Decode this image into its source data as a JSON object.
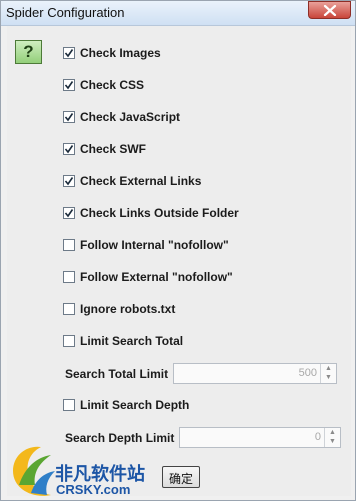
{
  "window": {
    "title": "Spider Configuration"
  },
  "help": {
    "glyph": "?"
  },
  "options": [
    {
      "label": "Check Images",
      "checked": true
    },
    {
      "label": "Check CSS",
      "checked": true
    },
    {
      "label": "Check JavaScript",
      "checked": true
    },
    {
      "label": "Check SWF",
      "checked": true
    },
    {
      "label": "Check External Links",
      "checked": true
    },
    {
      "label": "Check Links Outside Folder",
      "checked": true
    },
    {
      "label": "Follow Internal \"nofollow\"",
      "checked": false
    },
    {
      "label": "Follow External \"nofollow\"",
      "checked": false
    },
    {
      "label": "Ignore robots.txt",
      "checked": false
    },
    {
      "label": "Limit Search Total",
      "checked": false
    }
  ],
  "search_total": {
    "label": "Search Total Limit",
    "value": "500"
  },
  "limit_depth": {
    "label": "Limit Search Depth",
    "checked": false
  },
  "search_depth": {
    "label": "Search Depth Limit",
    "value": "0"
  },
  "ok_button": {
    "label": "确定"
  },
  "watermark": {
    "text_cn": "非凡软件站",
    "text_en": "CRSKY.com"
  }
}
